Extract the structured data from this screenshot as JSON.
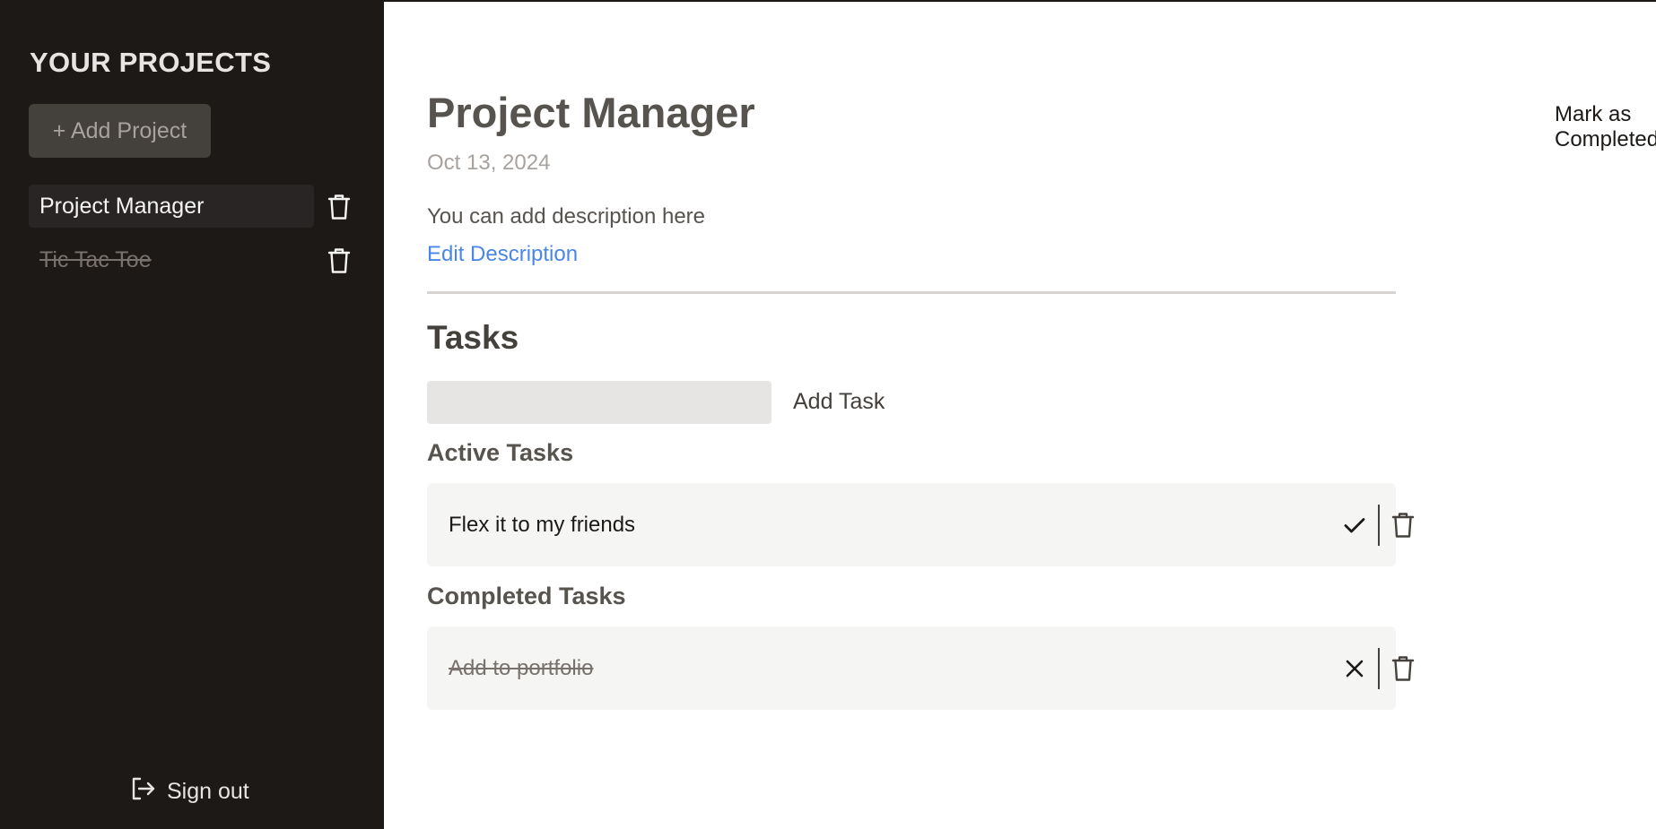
{
  "sidebar": {
    "title": "YOUR PROJECTS",
    "add_project_label": "+ Add Project",
    "projects": [
      {
        "name": "Project Manager",
        "selected": true,
        "completed": false
      },
      {
        "name": "Tic Tac Toe",
        "selected": false,
        "completed": true
      }
    ],
    "signout_label": "Sign out"
  },
  "project": {
    "title": "Project Manager",
    "mark_completed_label": "Mark as Completed",
    "date": "Oct 13, 2024",
    "description": "You can add description here",
    "edit_description_label": "Edit Description"
  },
  "tasks": {
    "heading": "Tasks",
    "input_value": "",
    "add_task_label": "Add Task",
    "active_heading": "Active Tasks",
    "active": [
      {
        "text": "Flex it to my friends"
      }
    ],
    "completed_heading": "Completed Tasks",
    "completed": [
      {
        "text": "Add to portfolio"
      }
    ]
  },
  "icons": {
    "trash": "trash-icon",
    "check": "check-icon",
    "close": "close-icon",
    "signout": "sign-out-icon"
  },
  "colors": {
    "sidebar_bg": "#1c1917",
    "link": "#4a86e8",
    "card_bg": "#f5f5f4"
  }
}
